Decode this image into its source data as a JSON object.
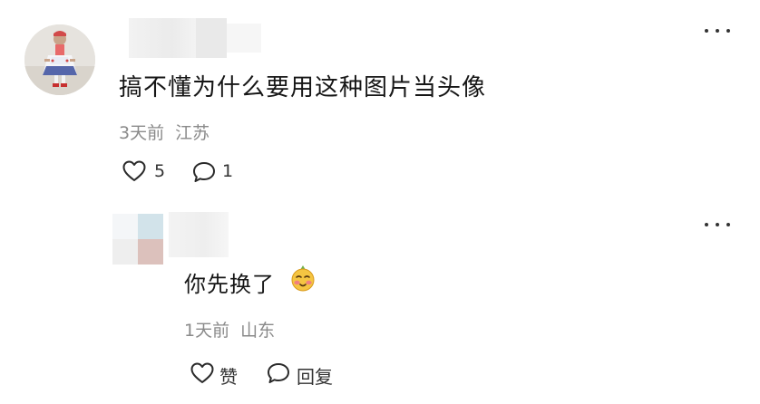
{
  "comments": [
    {
      "text": "搞不懂为什么要用这种图片当头像",
      "time": "3天前",
      "location": "江苏",
      "likes": "5",
      "replies": "1"
    },
    {
      "text": "你先换了",
      "time": "1天前",
      "location": "山东",
      "like_label": "赞",
      "reply_label": "回复",
      "emoji": "blushing-face-emoji"
    }
  ],
  "icons": {
    "more": "more-dots-icon",
    "like": "heart-outline-icon",
    "reply": "speech-bubble-icon"
  }
}
